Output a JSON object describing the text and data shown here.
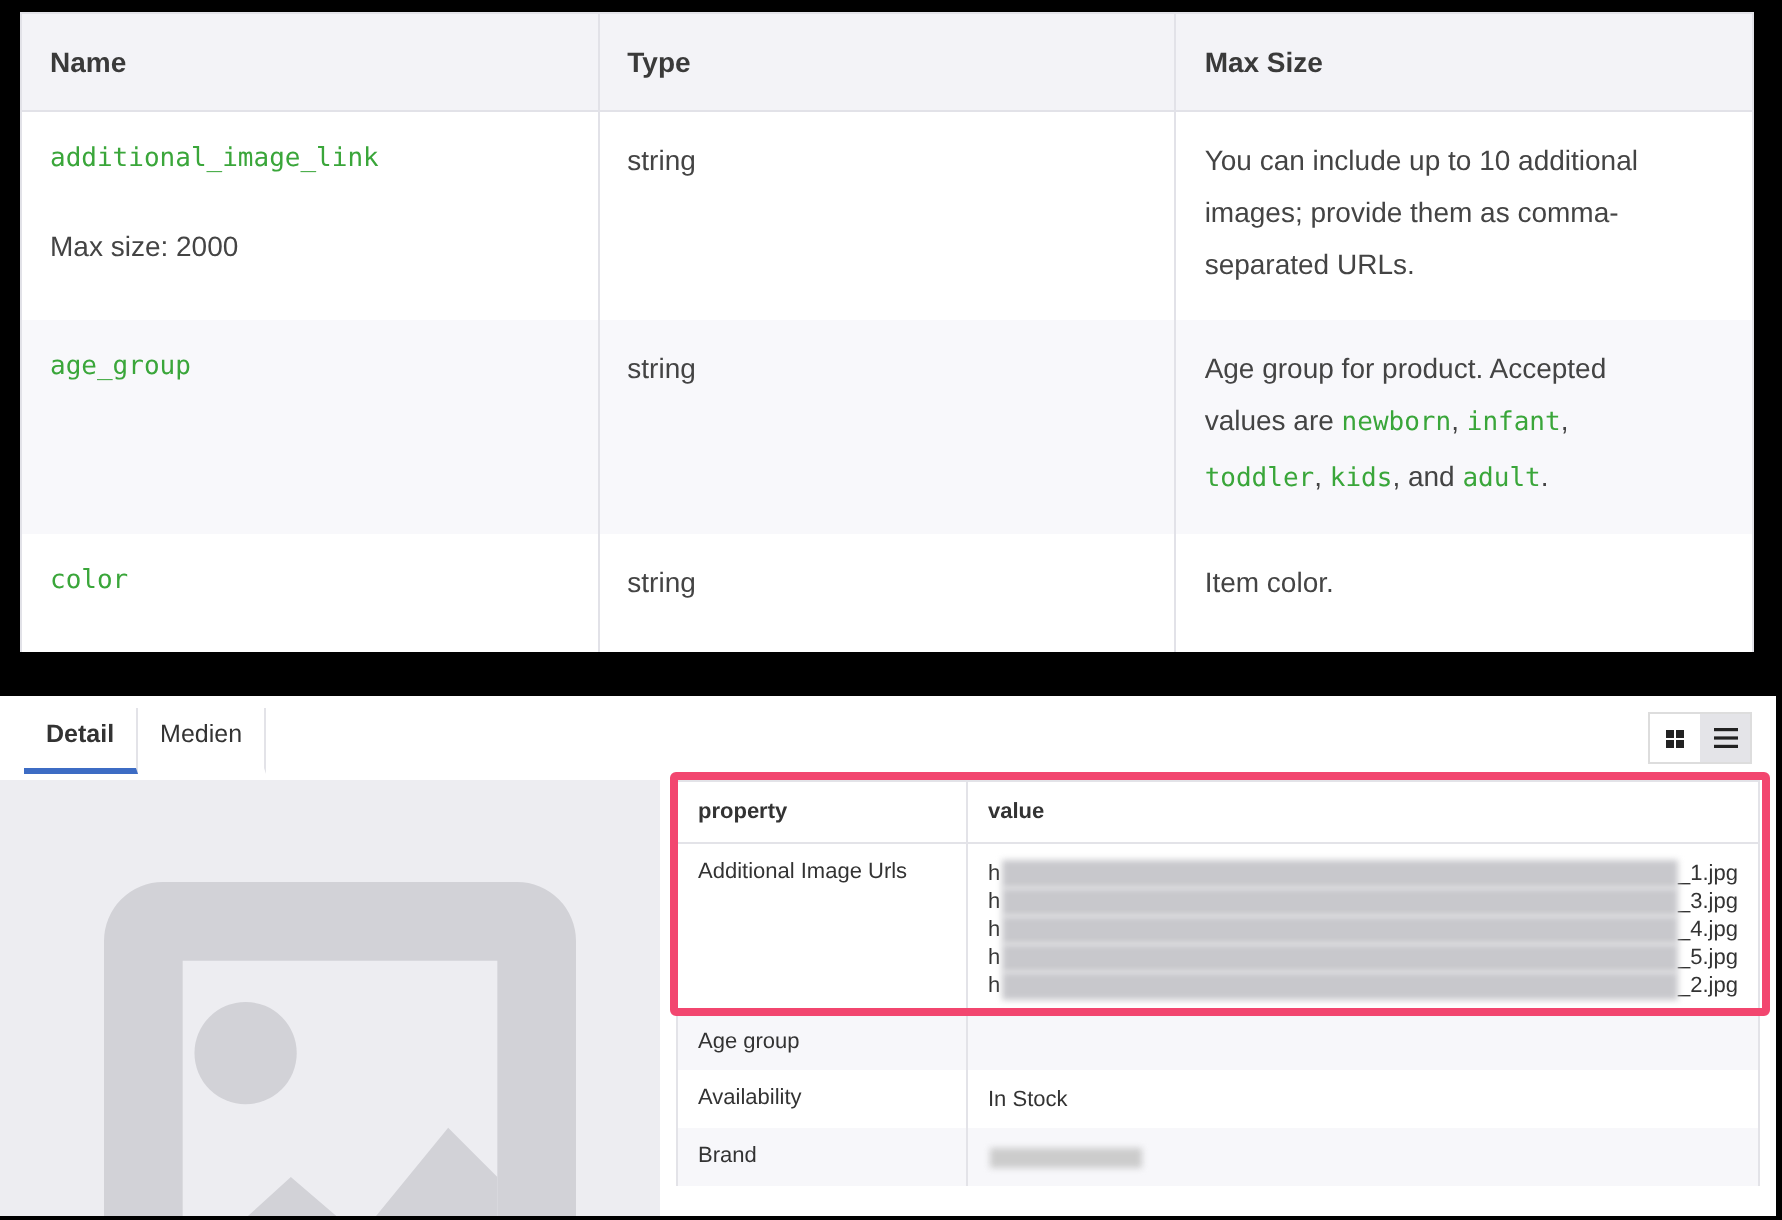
{
  "spec_table": {
    "columns": [
      "Name",
      "Type",
      "Max Size"
    ],
    "rows": [
      {
        "name": "additional_image_link",
        "note": "Max size: 2000",
        "type": "string",
        "description": [
          {
            "text": "You can include up to 10 additional images; provide them as comma-separated URLs.",
            "code": false
          }
        ]
      },
      {
        "name": "age_group",
        "type": "string",
        "description": [
          {
            "text": "Age group for product. Accepted values are ",
            "code": false
          },
          {
            "text": "newborn",
            "code": true
          },
          {
            "text": ", ",
            "code": false
          },
          {
            "text": "infant",
            "code": true
          },
          {
            "text": ", ",
            "code": false
          },
          {
            "text": "toddler",
            "code": true
          },
          {
            "text": ", ",
            "code": false
          },
          {
            "text": "kids",
            "code": true
          },
          {
            "text": ", and ",
            "code": false
          },
          {
            "text": "adult",
            "code": true
          },
          {
            "text": ".",
            "code": false
          }
        ]
      },
      {
        "name": "color",
        "type": "string",
        "description": [
          {
            "text": "Item color.",
            "code": false
          }
        ]
      }
    ]
  },
  "detail_view": {
    "tabs": [
      {
        "label": "Detail",
        "selected": true
      },
      {
        "label": "Medien",
        "selected": false
      }
    ],
    "view_toggle": [
      {
        "kind": "grid",
        "selected": false
      },
      {
        "kind": "list",
        "selected": true
      }
    ],
    "image": {
      "kind": "placeholder"
    },
    "table": {
      "columns": [
        "property",
        "value"
      ],
      "rows": [
        {
          "property": "Additional Image Urls",
          "highlighted": true,
          "lines": [
            {
              "start": "h",
              "end": "_1.jpg",
              "redacted": true
            },
            {
              "start": "h",
              "end": "_3.jpg",
              "redacted": true
            },
            {
              "start": "h",
              "end": "_4.jpg",
              "redacted": true
            },
            {
              "start": "h",
              "end": "_5.jpg",
              "redacted": true
            },
            {
              "start": "h",
              "end": "_2.jpg",
              "redacted": true
            }
          ]
        },
        {
          "property": "Age group",
          "highlighted": false,
          "lines": []
        },
        {
          "property": "Availability",
          "highlighted": false,
          "lines": [
            {
              "start": "In Stock",
              "redacted": false
            }
          ]
        },
        {
          "property": "Brand",
          "highlighted": false,
          "lines": [
            {
              "redacted": true
            }
          ]
        }
      ]
    }
  }
}
